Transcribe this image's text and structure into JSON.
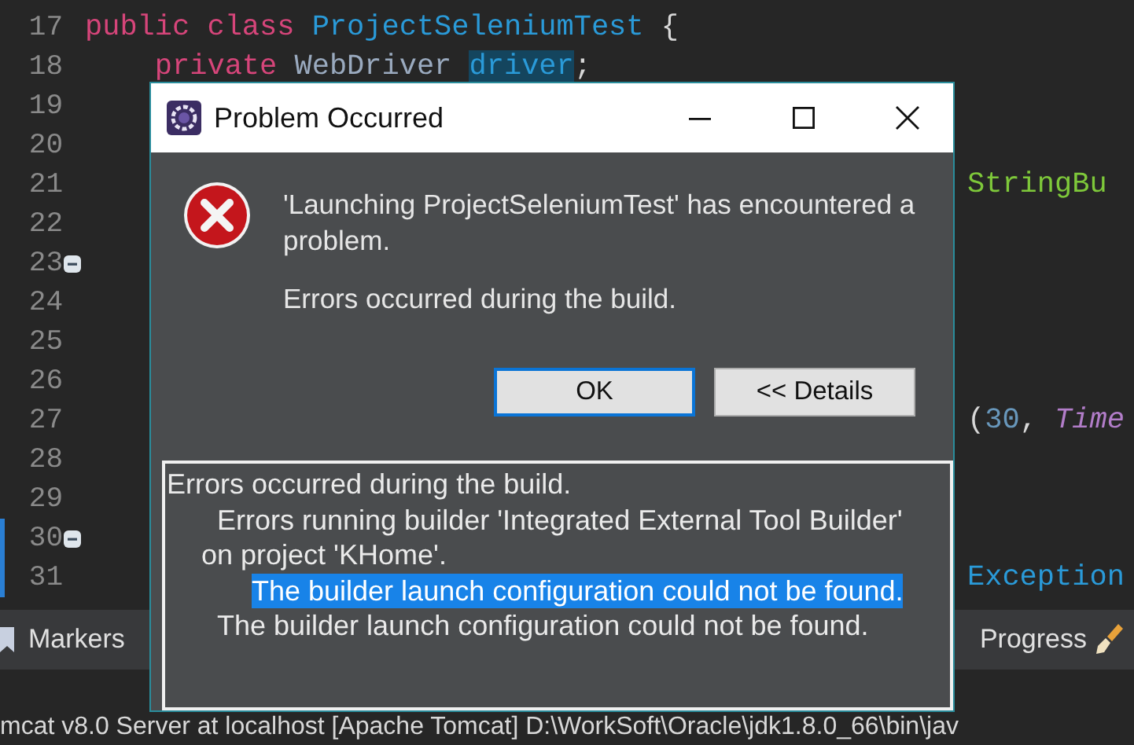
{
  "editor": {
    "lines": [
      {
        "number": "17",
        "fold": false,
        "marked": false,
        "code": [
          {
            "text": "public class ",
            "kind": "keyword"
          },
          {
            "text": "ProjectSeleniumTest",
            "kind": "type"
          },
          {
            "text": " {",
            "kind": "plain"
          }
        ]
      },
      {
        "number": "18",
        "fold": false,
        "marked": false,
        "code": [
          {
            "text": "    private ",
            "kind": "keyword"
          },
          {
            "text": "WebDriver ",
            "kind": "field"
          },
          {
            "text": "driver",
            "kind": "highlight"
          },
          {
            "text": ";",
            "kind": "plain"
          }
        ]
      },
      {
        "number": "19",
        "fold": false,
        "marked": false
      },
      {
        "number": "20",
        "fold": false,
        "marked": false
      },
      {
        "number": "21",
        "fold": false,
        "marked": false,
        "tail": [
          {
            "text": "StringBu",
            "kind": "string"
          }
        ]
      },
      {
        "number": "22",
        "fold": false,
        "marked": false
      },
      {
        "number": "23",
        "fold": true,
        "marked": false
      },
      {
        "number": "24",
        "fold": false,
        "marked": false
      },
      {
        "number": "25",
        "fold": false,
        "marked": false
      },
      {
        "number": "26",
        "fold": false,
        "marked": false
      },
      {
        "number": "27",
        "fold": false,
        "marked": false,
        "tail": [
          {
            "text": "(",
            "kind": "plain"
          },
          {
            "text": "30",
            "kind": "number"
          },
          {
            "text": ", ",
            "kind": "plain"
          },
          {
            "text": "Time",
            "kind": "italic"
          }
        ]
      },
      {
        "number": "28",
        "fold": false,
        "marked": false
      },
      {
        "number": "29",
        "fold": false,
        "marked": false
      },
      {
        "number": "30",
        "fold": true,
        "marked": true
      },
      {
        "number": "31",
        "fold": false,
        "marked": true,
        "tail": [
          {
            "text": "Exception",
            "kind": "type"
          }
        ]
      }
    ]
  },
  "panel_tabs": [
    {
      "label": "Markers"
    },
    {
      "label": "Progress"
    }
  ],
  "console": {
    "text": "mcat v8.0 Server at localhost [Apache Tomcat] D:\\WorkSoft\\Oracle\\jdk1.8.0_66\\bin\\jav"
  },
  "dialog": {
    "title": "Problem Occurred",
    "message": "'Launching ProjectSeleniumTest' has encountered a problem.",
    "detail": "Errors occurred during the build.",
    "buttons": [
      {
        "label": "OK",
        "selected": true
      },
      {
        "label": "<< Details",
        "selected": false
      }
    ],
    "details": [
      {
        "text": "Errors occurred during the build.",
        "selected": false,
        "children": [
          {
            "text": "Errors running builder 'Integrated External Tool Builder' on project 'KHome'.",
            "selected": false,
            "children": [
              {
                "text": "The builder launch configuration could not be found.",
                "selected": true
              }
            ]
          },
          {
            "text": "The builder launch configuration could not be found.",
            "selected": false
          }
        ]
      }
    ]
  }
}
